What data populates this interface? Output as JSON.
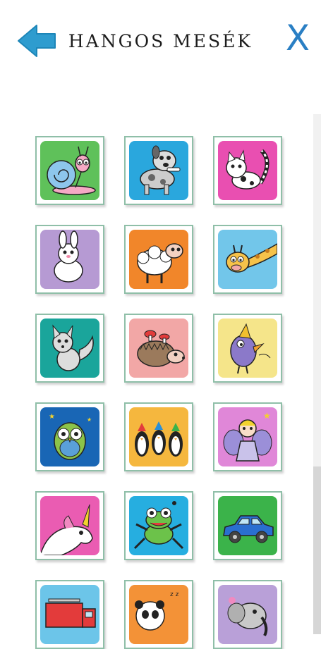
{
  "header": {
    "title": "HANGOS MESÉK",
    "back_icon": "back-arrow-icon",
    "close_label": "X",
    "accent_color": "#2a7fc4"
  },
  "grid": {
    "tiles": [
      {
        "icon": "snail-icon",
        "bg": "#5fc15a"
      },
      {
        "icon": "dog-icon",
        "bg": "#2aa7dd"
      },
      {
        "icon": "cat-icon",
        "bg": "#e94fb1"
      },
      {
        "icon": "rabbit-icon",
        "bg": "#b69ad3"
      },
      {
        "icon": "sheep-icon",
        "bg": "#f1862a"
      },
      {
        "icon": "giraffe-icon",
        "bg": "#72c6ea"
      },
      {
        "icon": "fox-icon",
        "bg": "#1aa59b"
      },
      {
        "icon": "hedgehog-icon",
        "bg": "#f2a7a6"
      },
      {
        "icon": "bird-icon",
        "bg": "#f5e58a"
      },
      {
        "icon": "owl-icon",
        "bg": "#1966b5"
      },
      {
        "icon": "penguins-icon",
        "bg": "#f5b73e"
      },
      {
        "icon": "fairy-icon",
        "bg": "#e087d8"
      },
      {
        "icon": "unicorn-icon",
        "bg": "#ea5cb2"
      },
      {
        "icon": "frog-icon",
        "bg": "#26aee0"
      },
      {
        "icon": "car-icon",
        "bg": "#3bb34a"
      },
      {
        "icon": "fire-truck-icon",
        "bg": "#6cc5e9"
      },
      {
        "icon": "panda-icon",
        "bg": "#f39237"
      },
      {
        "icon": "elephant-icon",
        "bg": "#b9a0d8"
      }
    ]
  }
}
